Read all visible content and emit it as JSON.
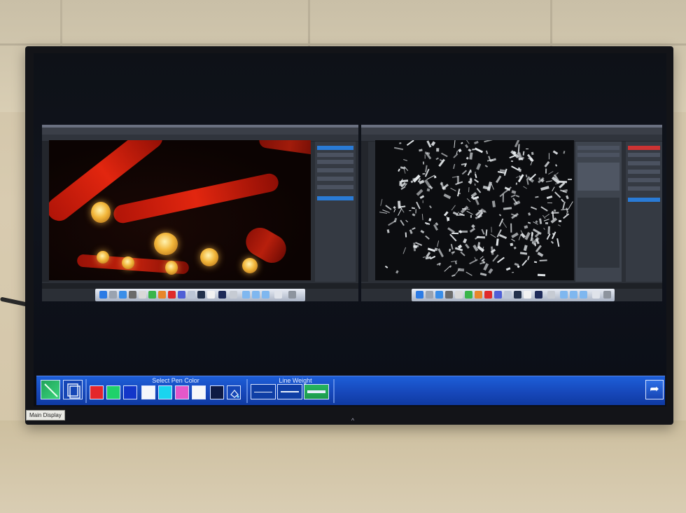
{
  "overlay": {
    "main_display_label": "Main Display"
  },
  "pen_toolbar": {
    "pen_color_label": "Select Pen Color",
    "line_weight_label": "Line Weight",
    "colors": [
      "#e4262b",
      "#1fd16a",
      "#1336c9",
      "#f4f6fb",
      "#19d4ef",
      "#e357c9",
      "#f6f7f9",
      "#0e1a44"
    ],
    "line_weights": [
      "thin",
      "medium",
      "thick"
    ],
    "return_icon": "curved-arrow-icon"
  },
  "photoshop_windows": [
    {
      "side": "left",
      "image": "red-lanterns"
    },
    {
      "side": "right",
      "image": "white-shards"
    }
  ]
}
